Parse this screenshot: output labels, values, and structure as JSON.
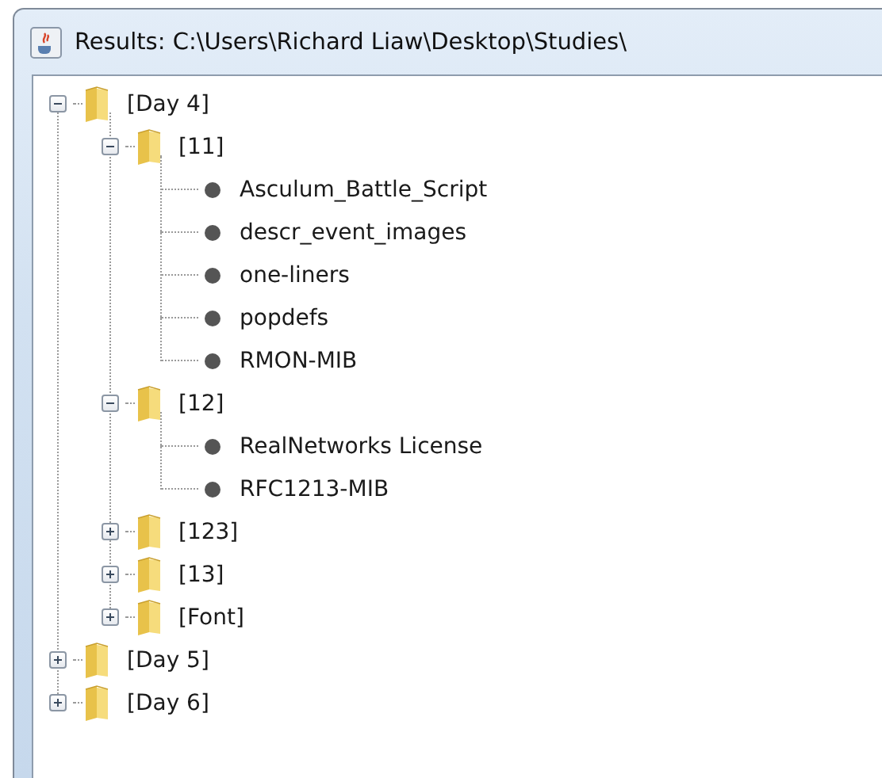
{
  "window": {
    "title": "Results: C:\\Users\\Richard Liaw\\Desktop\\Studies\\"
  },
  "tree": {
    "items": [
      {
        "kind": "folder",
        "label": "[Day 4]",
        "expanded": true,
        "children": [
          {
            "kind": "folder",
            "label": "[11]",
            "expanded": true,
            "children": [
              {
                "kind": "file",
                "label": "Asculum_Battle_Script"
              },
              {
                "kind": "file",
                "label": "descr_event_images"
              },
              {
                "kind": "file",
                "label": "one-liners"
              },
              {
                "kind": "file",
                "label": "popdefs"
              },
              {
                "kind": "file",
                "label": "RMON-MIB"
              }
            ]
          },
          {
            "kind": "folder",
            "label": "[12]",
            "expanded": true,
            "children": [
              {
                "kind": "file",
                "label": "RealNetworks License"
              },
              {
                "kind": "file",
                "label": "RFC1213-MIB"
              }
            ]
          },
          {
            "kind": "folder",
            "label": "[123]",
            "expanded": false
          },
          {
            "kind": "folder",
            "label": "[13]",
            "expanded": false
          },
          {
            "kind": "folder",
            "label": "[Font]",
            "expanded": false
          }
        ]
      },
      {
        "kind": "folder",
        "label": "[Day 5]",
        "expanded": false
      },
      {
        "kind": "folder",
        "label": "[Day 6]",
        "expanded": false
      }
    ]
  }
}
